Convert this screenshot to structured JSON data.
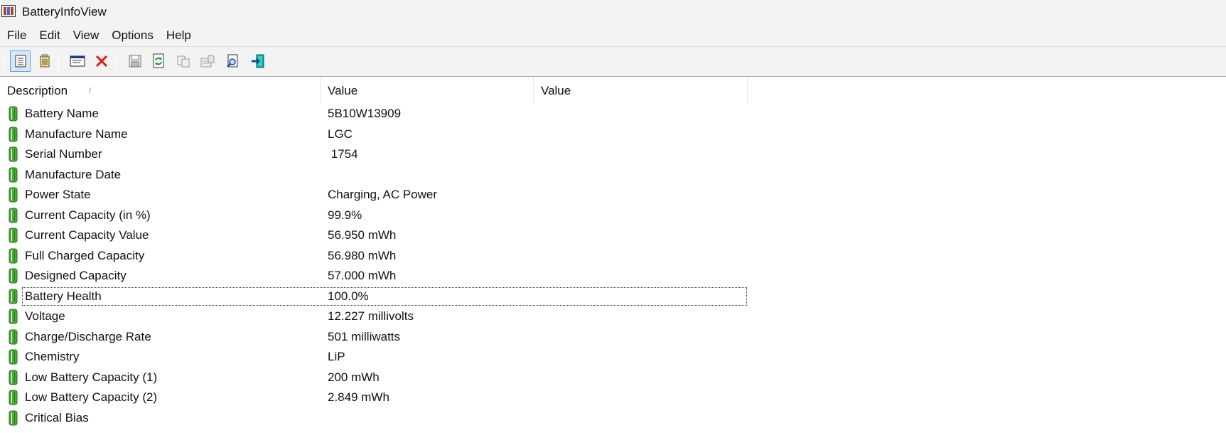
{
  "window": {
    "title": "BatteryInfoView"
  },
  "menu": [
    "File",
    "Edit",
    "View",
    "Options",
    "Help"
  ],
  "toolbar": {
    "buttons": [
      "view-list-icon",
      "view-html-icon",
      "properties-window-icon",
      "delete-icon",
      "save-icon",
      "refresh-icon",
      "copy-icon",
      "properties-icon",
      "find-icon",
      "exit-icon"
    ]
  },
  "columns": [
    "Description",
    "Value",
    "Value"
  ],
  "sort_indicator": "/",
  "rows": [
    {
      "description": "Battery Name",
      "value": "5B10W13909",
      "value2": ""
    },
    {
      "description": "Manufacture Name",
      "value": "LGC",
      "value2": ""
    },
    {
      "description": "Serial Number",
      "value": " 1754",
      "value2": ""
    },
    {
      "description": "Manufacture Date",
      "value": "",
      "value2": ""
    },
    {
      "description": "Power State",
      "value": "Charging, AC Power",
      "value2": ""
    },
    {
      "description": "Current Capacity (in %)",
      "value": "99.9%",
      "value2": ""
    },
    {
      "description": "Current Capacity Value",
      "value": "56.950 mWh",
      "value2": ""
    },
    {
      "description": "Full Charged Capacity",
      "value": "56.980 mWh",
      "value2": ""
    },
    {
      "description": "Designed Capacity",
      "value": "57.000 mWh",
      "value2": ""
    },
    {
      "description": "Battery Health",
      "value": "100.0%",
      "value2": ""
    },
    {
      "description": "Voltage",
      "value": "12.227 millivolts",
      "value2": ""
    },
    {
      "description": "Charge/Discharge Rate",
      "value": "501 milliwatts",
      "value2": ""
    },
    {
      "description": "Chemistry",
      "value": "LiP",
      "value2": ""
    },
    {
      "description": "Low Battery Capacity (1)",
      "value": "200 mWh",
      "value2": ""
    },
    {
      "description": "Low Battery Capacity (2)",
      "value": "2.849 mWh",
      "value2": ""
    },
    {
      "description": "Critical Bias",
      "value": "",
      "value2": ""
    }
  ],
  "focused_row": "Battery Health",
  "colors": {
    "battery_green": "#4caf3a",
    "selection_border": "#5ea0dd"
  }
}
